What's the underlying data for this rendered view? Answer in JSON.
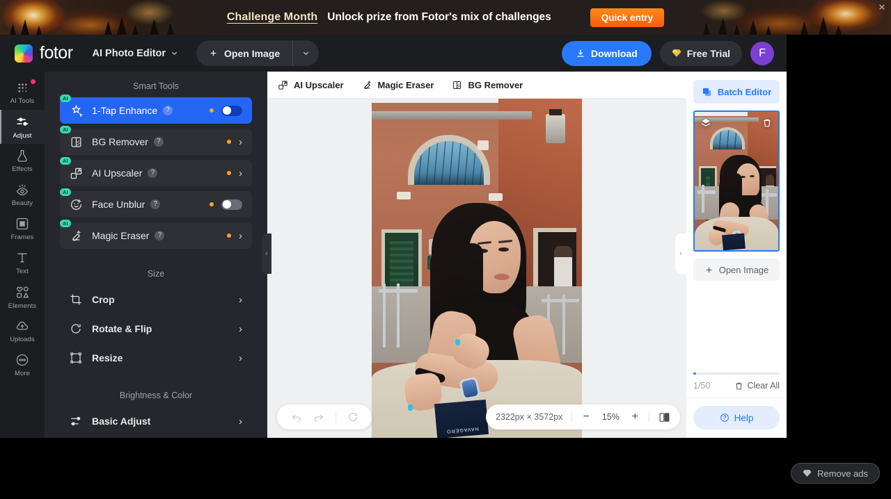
{
  "banner": {
    "highlight": "Challenge Month",
    "text": "Unlock prize from Fotor's mix of challenges",
    "cta": "Quick entry",
    "close": "✕"
  },
  "header": {
    "brand": "fotor",
    "mode": "AI Photo Editor",
    "open_image": "Open Image",
    "download": "Download",
    "free_trial": "Free Trial",
    "avatar_initial": "F"
  },
  "rail": {
    "items": [
      {
        "label": "AI Tools",
        "icon": "ai-tools-icon",
        "badge": true,
        "active": false
      },
      {
        "label": "Adjust",
        "icon": "adjust-icon",
        "badge": false,
        "active": true
      },
      {
        "label": "Effects",
        "icon": "effects-icon",
        "badge": false,
        "active": false
      },
      {
        "label": "Beauty",
        "icon": "beauty-icon",
        "badge": false,
        "active": false
      },
      {
        "label": "Frames",
        "icon": "frames-icon",
        "badge": false,
        "active": false
      },
      {
        "label": "Text",
        "icon": "text-icon",
        "badge": false,
        "active": false
      },
      {
        "label": "Elements",
        "icon": "elements-icon",
        "badge": false,
        "active": false
      },
      {
        "label": "Uploads",
        "icon": "uploads-icon",
        "badge": false,
        "active": false
      },
      {
        "label": "More",
        "icon": "more-icon",
        "badge": false,
        "active": false
      }
    ]
  },
  "panel": {
    "sections": [
      {
        "title": "Smart Tools",
        "rows": [
          {
            "label": "1-Tap Enhance",
            "ai": "AI",
            "dot": true,
            "control": "toggle-on",
            "active": true
          },
          {
            "label": "BG Remover",
            "ai": "AI",
            "dot": true,
            "control": "chevron",
            "active": false
          },
          {
            "label": "AI Upscaler",
            "ai": "AI",
            "dot": true,
            "control": "chevron",
            "active": false
          },
          {
            "label": "Face Unblur",
            "ai": "AI",
            "dot": true,
            "control": "toggle-off",
            "active": false
          },
          {
            "label": "Magic Eraser",
            "ai": "AI",
            "dot": true,
            "control": "chevron",
            "active": false
          }
        ]
      },
      {
        "title": "Size",
        "rows": [
          {
            "label": "Crop",
            "control": "chevron"
          },
          {
            "label": "Rotate & Flip",
            "control": "chevron"
          },
          {
            "label": "Resize",
            "control": "chevron"
          }
        ]
      },
      {
        "title": "Brightness & Color",
        "rows": [
          {
            "label": "Basic Adjust",
            "control": "chevron"
          }
        ]
      }
    ],
    "help_glyph": "?",
    "chevron_glyph": "›",
    "collapse_left_glyph": "‹",
    "collapse_right_glyph": "›"
  },
  "canvas": {
    "tools": [
      {
        "label": "AI Upscaler",
        "icon": "upscale-icon"
      },
      {
        "label": "Magic Eraser",
        "icon": "eraser-icon"
      },
      {
        "label": "BG Remover",
        "icon": "bg-remover-icon"
      }
    ],
    "dimensions": "2322px × 3572px",
    "zoom": "15%",
    "zoom_out": "−",
    "zoom_in": "+",
    "photo_book_text": "NAVAGERO"
  },
  "right_panel": {
    "batch_editor": "Batch Editor",
    "open_image": "Open Image",
    "count": "1/50",
    "clear_all": "Clear All",
    "help": "Help"
  },
  "remove_ads": {
    "label": "Remove ads"
  },
  "colors": {
    "accent_blue": "#2979ff",
    "active_row_blue": "#2565f5",
    "ai_badge_teal": "#31dcb1",
    "pro_dot_orange": "#f5a623",
    "badge_red": "#f0356a",
    "avatar_purple": "#7b3fd4",
    "cta_orange": "#f95b0e",
    "panel_bg": "#26272c",
    "header_bg": "#1c1d21"
  }
}
